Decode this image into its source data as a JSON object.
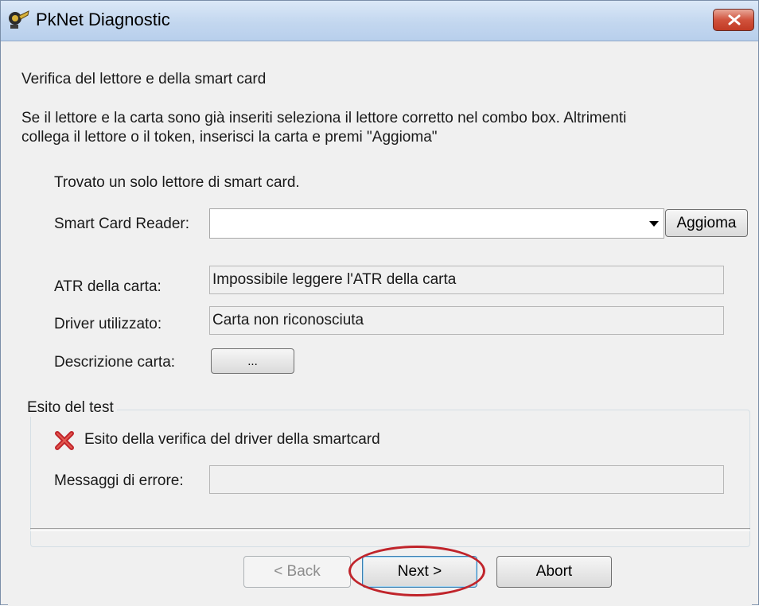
{
  "window": {
    "title": "PkNet Diagnostic"
  },
  "heading": "Verifica del lettore e della smart card",
  "description": {
    "line1": "Se il lettore e la carta sono già inseriti seleziona il lettore corretto nel combo box. Altrimenti",
    "line2": "collega il lettore o il token, inserisci la carta e premi \"Aggioma\""
  },
  "status_found": "Trovato un solo lettore di smart card.",
  "reader": {
    "label": "Smart Card Reader:",
    "value": "",
    "refresh_label": "Aggioma"
  },
  "atr": {
    "label": "ATR della carta:",
    "value": "Impossibile leggere l'ATR della carta"
  },
  "driver": {
    "label": "Driver utilizzato:",
    "value": "Carta non riconosciuta"
  },
  "card_description": {
    "label": "Descrizione carta:",
    "button_label": "..."
  },
  "test_result": {
    "group_title": "Esito del test",
    "status_icon": "red-x-icon",
    "status_text": "Esito della verifica del driver della smartcard",
    "errors_label": "Messaggi di errore:",
    "errors_value": ""
  },
  "buttons": {
    "back": "< Back",
    "next": "Next >",
    "abort": "Abort"
  },
  "colors": {
    "error_red": "#c0242b",
    "accent": "#3c7fb1"
  }
}
